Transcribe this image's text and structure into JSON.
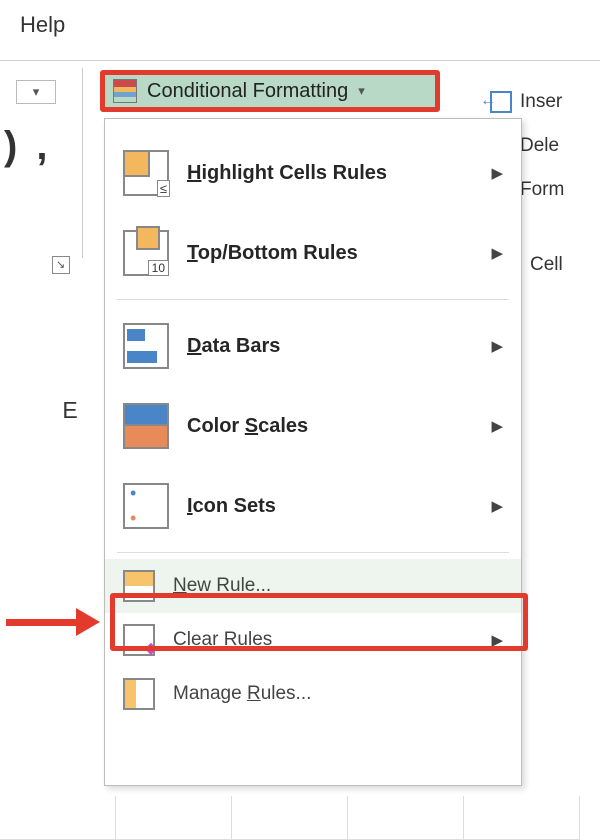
{
  "tab": {
    "help": "Help"
  },
  "number_fmt": {
    "sample": ") ,"
  },
  "cf_button": {
    "label": "Conditional Formatting"
  },
  "side": {
    "insert": "Inser",
    "delete": "Dele",
    "format": "Form",
    "group": "Cell"
  },
  "menu": {
    "highlight": "Highlight Cells Rules",
    "topbottom": "Top/Bottom Rules",
    "databars": "Data Bars",
    "colorscales": "Color Scales",
    "iconsets": "Icon Sets",
    "newrule": "New Rule...",
    "clear": "Clear Rules",
    "manage": "Manage Rules..."
  },
  "sheet": {
    "colE": "E"
  }
}
